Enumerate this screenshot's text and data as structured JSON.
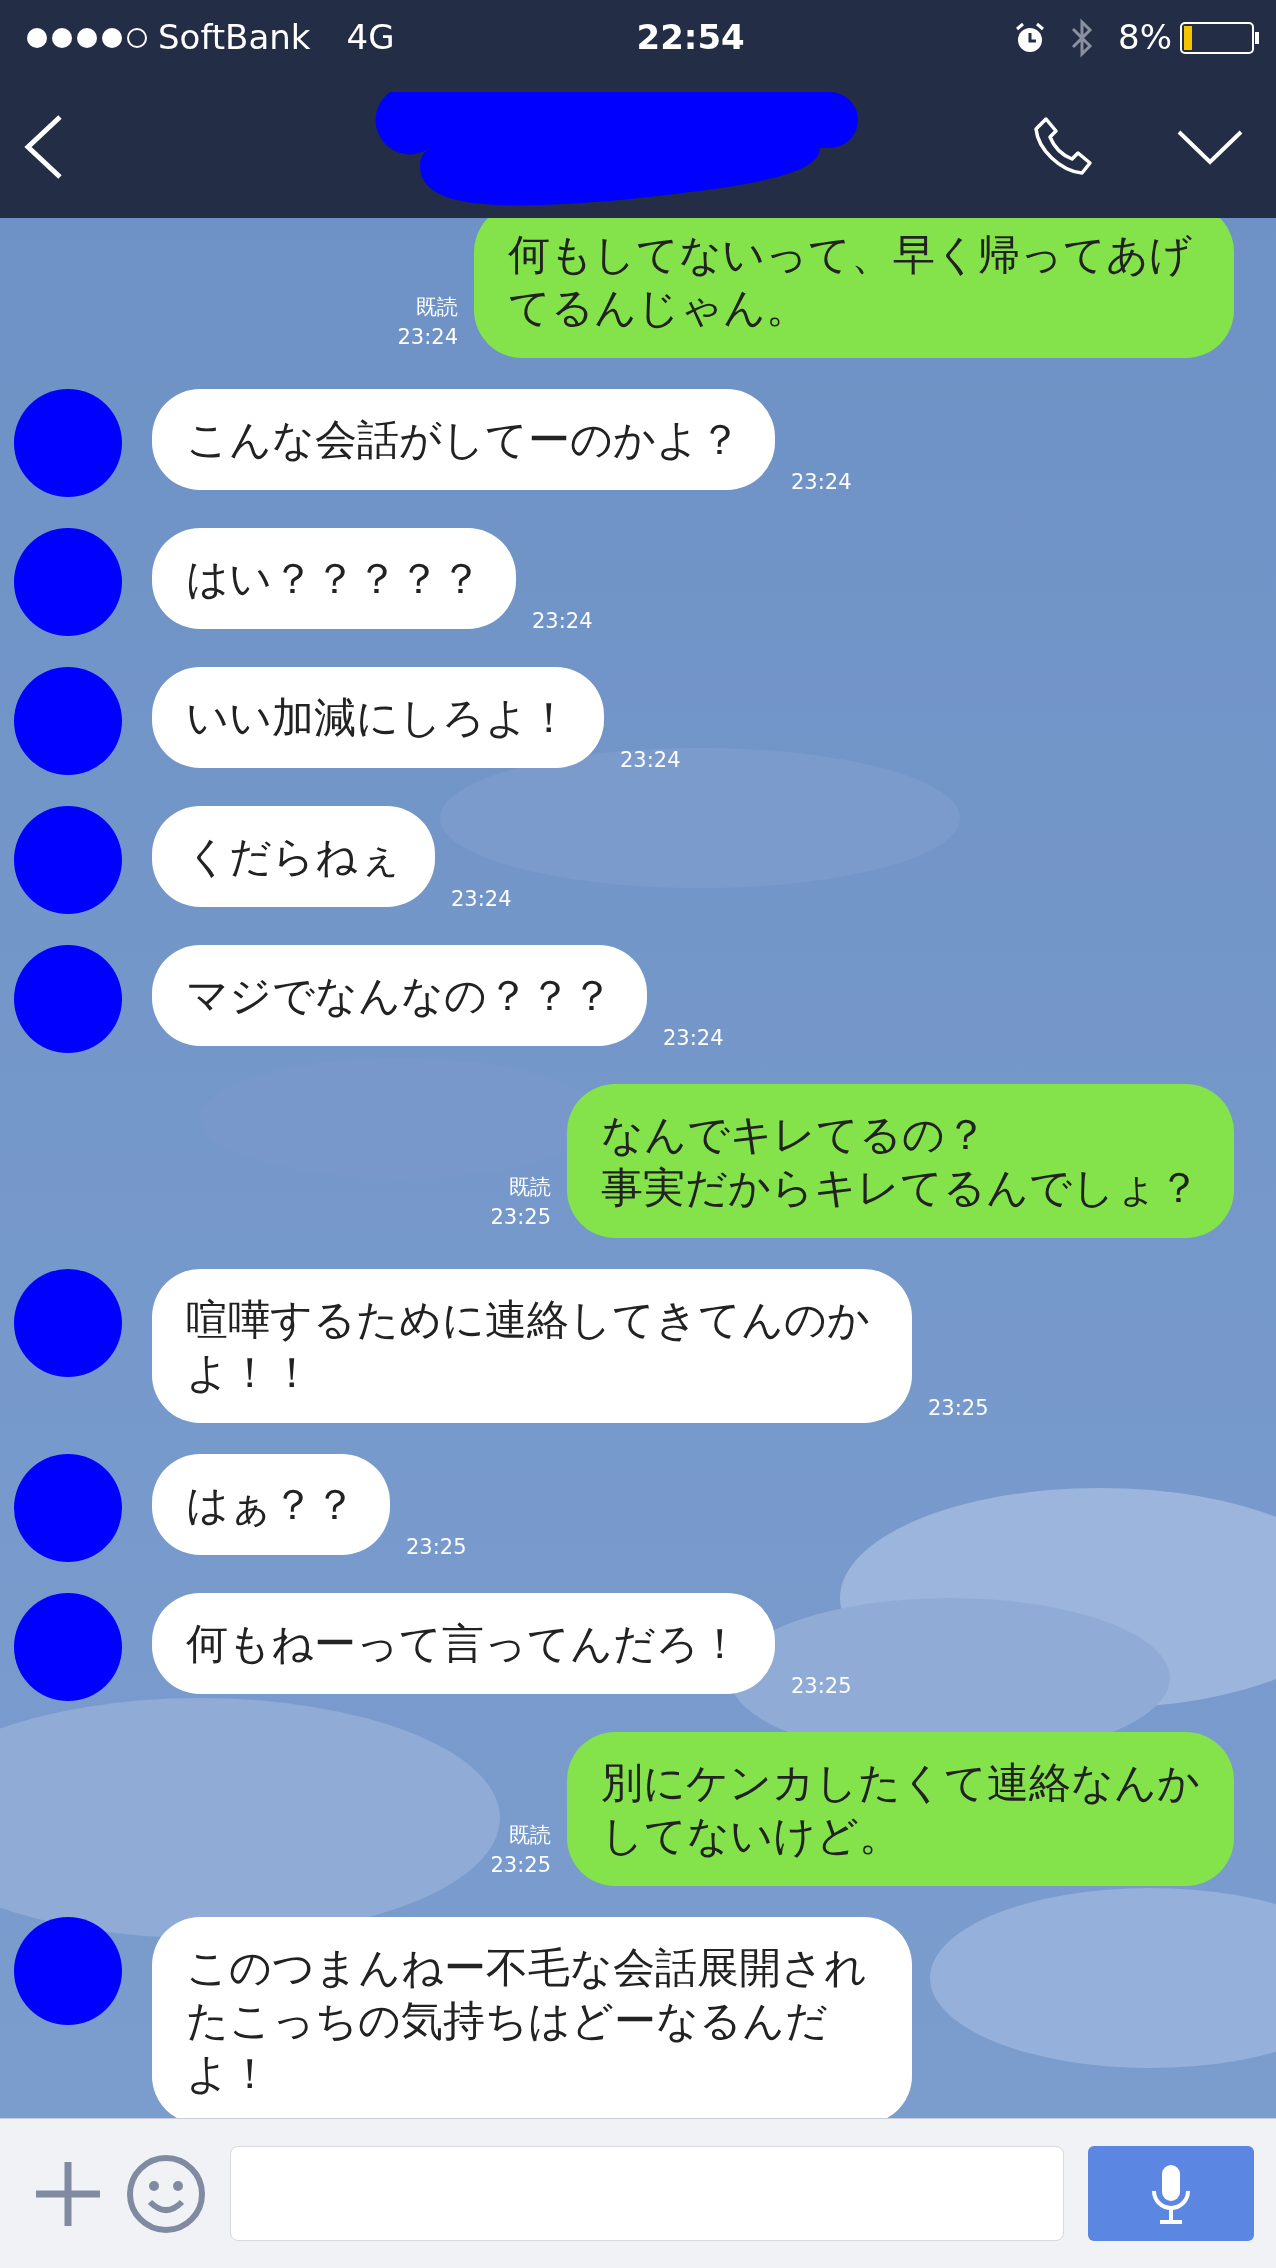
{
  "status_bar": {
    "carrier": "SoftBank",
    "network": "4G",
    "time": "22:54",
    "battery": "8%"
  },
  "messages": [
    {
      "kind": "sent",
      "lines": [
        "何もしてないって、早く帰ってあげてるんじゃん。"
      ],
      "read": "既読",
      "time": "23:24"
    },
    {
      "kind": "received",
      "lines": [
        "こんな会話がしてーのかよ？"
      ],
      "time": "23:24"
    },
    {
      "kind": "received",
      "lines": [
        "はい？？？？？"
      ],
      "time": "23:24"
    },
    {
      "kind": "received",
      "lines": [
        "いい加減にしろよ！"
      ],
      "time": "23:24"
    },
    {
      "kind": "received",
      "lines": [
        "くだらねぇ"
      ],
      "time": "23:24"
    },
    {
      "kind": "received",
      "lines": [
        "マジでなんなの？？？"
      ],
      "time": "23:24"
    },
    {
      "kind": "sent",
      "lines": [
        "なんでキレてるの？",
        "事実だからキレてるんでしょ？"
      ],
      "read": "既読",
      "time": "23:25"
    },
    {
      "kind": "received",
      "lines": [
        "喧嘩するために連絡してきてんのかよ！！"
      ],
      "time": "23:25"
    },
    {
      "kind": "received",
      "lines": [
        "はぁ？？"
      ],
      "time": "23:25"
    },
    {
      "kind": "received",
      "lines": [
        "何もねーって言ってんだろ！"
      ],
      "time": "23:25"
    },
    {
      "kind": "sent",
      "lines": [
        "別にケンカしたくて連絡なんか",
        "してないけど。"
      ],
      "read": "既読",
      "time": "23:25"
    },
    {
      "kind": "received",
      "lines": [
        "このつまんねー不毛な会話展開されたこっちの気持ちはどーなるんだよ！"
      ]
    }
  ]
}
